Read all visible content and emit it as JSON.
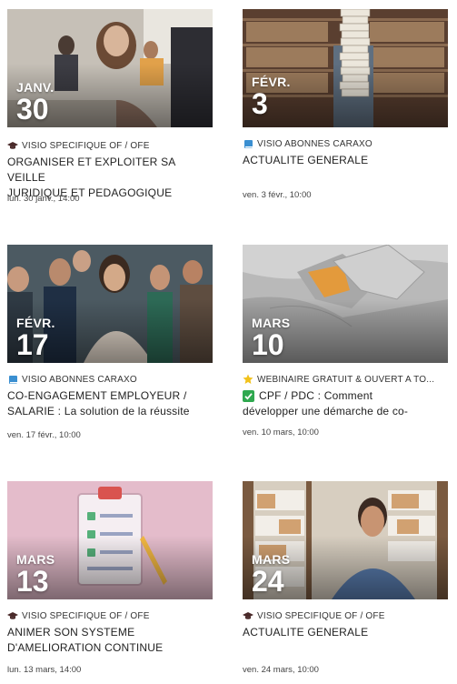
{
  "cards": [
    {
      "month": "JANV.",
      "day": "30",
      "category": "VISIO SPECIFIQUE OF / OFE",
      "category_icon": "graduation-cap-icon",
      "title_lines": [
        "ORGANISER ET EXPLOITER SA VEILLE",
        "JURIDIQUE ET PEDAGOGIQUE"
      ],
      "datetime": "lun. 30 janv., 14:00"
    },
    {
      "month": "FÉVR.",
      "day": "3",
      "category": "VISIO ABONNES CARAXO",
      "category_icon": "book-icon",
      "title_lines": [
        "ACTUALITE GENERALE"
      ],
      "datetime": "ven. 3 févr., 10:00"
    },
    {
      "month": "FÉVR.",
      "day": "17",
      "category": "VISIO ABONNES CARAXO",
      "category_icon": "book-icon",
      "title_lines": [
        "CO-ENGAGEMENT EMPLOYEUR /",
        "SALARIE : La solution de la réussite"
      ],
      "datetime": "ven. 17 févr., 10:00"
    },
    {
      "month": "MARS",
      "day": "10",
      "category": "WEBINAIRE GRATUIT & OUVERT A TO...",
      "category_icon": "star-icon",
      "title_prefix_icon": "check-box-icon",
      "title_lines": [
        "CPF / PDC : Comment",
        "développer une démarche de co-"
      ],
      "datetime": "ven. 10 mars, 10:00"
    },
    {
      "month": "MARS",
      "day": "13",
      "category": "VISIO SPECIFIQUE OF / OFE",
      "category_icon": "graduation-cap-icon",
      "title_lines": [
        "ANIMER SON SYSTEME",
        "D'AMELIORATION CONTINUE"
      ],
      "datetime": "lun. 13 mars, 14:00"
    },
    {
      "month": "MARS",
      "day": "24",
      "category": "VISIO SPECIFIQUE OF / OFE",
      "category_icon": "graduation-cap-icon",
      "title_lines": [
        "ACTUALITE GENERALE"
      ],
      "datetime": "ven. 24 mars, 10:00"
    }
  ]
}
